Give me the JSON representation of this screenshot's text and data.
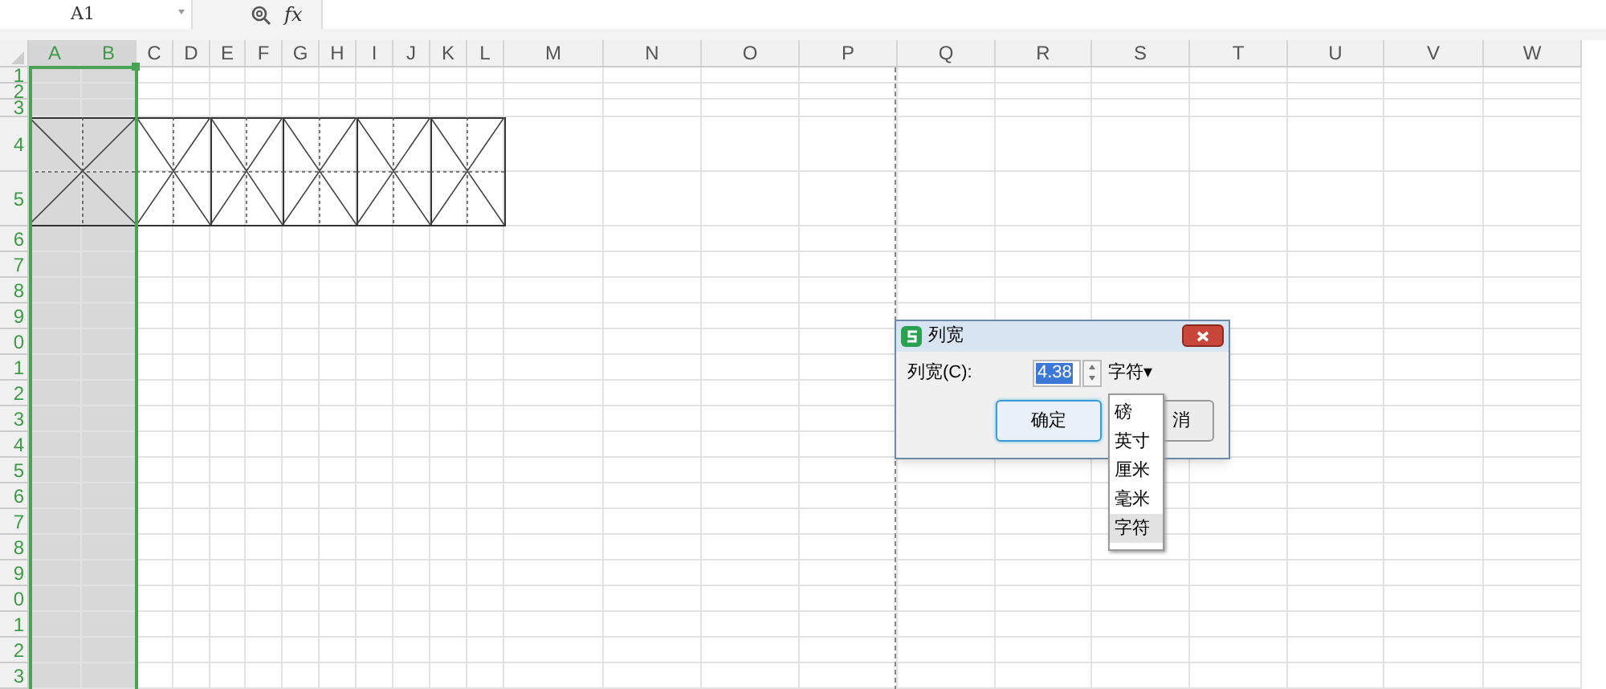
{
  "name_box": {
    "value": "A1"
  },
  "formula_bar": {
    "fx": "fx"
  },
  "columns": [
    {
      "label": "A",
      "selected": true
    },
    {
      "label": "B",
      "selected": true
    },
    {
      "label": "C",
      "selected": false
    },
    {
      "label": "D",
      "selected": false
    },
    {
      "label": "E",
      "selected": false
    },
    {
      "label": "F",
      "selected": false
    },
    {
      "label": "G",
      "selected": false
    },
    {
      "label": "H",
      "selected": false
    },
    {
      "label": "I",
      "selected": false
    },
    {
      "label": "J",
      "selected": false
    },
    {
      "label": "K",
      "selected": false
    },
    {
      "label": "L",
      "selected": false
    },
    {
      "label": "M",
      "selected": false
    },
    {
      "label": "N",
      "selected": false
    },
    {
      "label": "O",
      "selected": false
    },
    {
      "label": "P",
      "selected": false
    },
    {
      "label": "Q",
      "selected": false
    },
    {
      "label": "R",
      "selected": false
    },
    {
      "label": "S",
      "selected": false
    },
    {
      "label": "T",
      "selected": false
    },
    {
      "label": "U",
      "selected": false
    },
    {
      "label": "V",
      "selected": false
    },
    {
      "label": "W",
      "selected": false
    }
  ],
  "rows": [
    "1",
    "2",
    "3",
    "4",
    "5",
    "6",
    "7",
    "8",
    "9",
    "0",
    "1",
    "2",
    "3",
    "4",
    "5",
    "6",
    "7",
    "8",
    "9",
    "0",
    "1",
    "2",
    "3"
  ],
  "dialog": {
    "title": "列宽",
    "label": "列宽(C):",
    "value": "4.38",
    "unit": "字符▾",
    "ok": "确定",
    "cancel": "消"
  },
  "unit_menu": [
    {
      "label": "磅",
      "selected": false
    },
    {
      "label": "英寸",
      "selected": false
    },
    {
      "label": "厘米",
      "selected": false
    },
    {
      "label": "毫米",
      "selected": false
    },
    {
      "label": "字符",
      "selected": true
    }
  ]
}
